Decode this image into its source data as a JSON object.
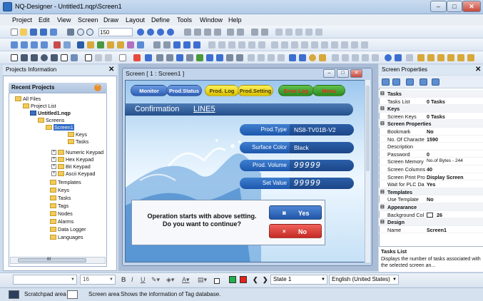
{
  "window": {
    "title": "NQ-Designer - Untitled1.nqp\\Screen1",
    "min": "–",
    "max": "□",
    "close": "✕"
  },
  "menu": [
    "Project",
    "Edit",
    "View",
    "Screen",
    "Draw",
    "Layout",
    "Define",
    "Tools",
    "Window",
    "Help"
  ],
  "toolbar": {
    "zoom": "150"
  },
  "projects_panel": {
    "title": "Projects Information",
    "close": "✕",
    "recent_header": "Recent Projects",
    "tree": [
      {
        "label": "All Files",
        "level": 0
      },
      {
        "label": "Project List",
        "level": 1
      },
      {
        "label": "Untitled1.nqp",
        "level": 2,
        "bold": true
      },
      {
        "label": "Screens",
        "level": 3
      },
      {
        "label": "Screen1",
        "level": 4,
        "selected": true
      },
      {
        "label": "Keys",
        "level": 5
      },
      {
        "label": "Tasks",
        "level": 5
      },
      {
        "label": "Numeric Keypad",
        "level": 4
      },
      {
        "label": "Hex Keypad",
        "level": 4
      },
      {
        "label": "Bit Keypad",
        "level": 4
      },
      {
        "label": "Ascii Keypad",
        "level": 4
      },
      {
        "label": "Templates",
        "level": 3
      },
      {
        "label": "Keys",
        "level": 3
      },
      {
        "label": "Tasks",
        "level": 3
      },
      {
        "label": "Tags",
        "level": 3
      },
      {
        "label": "Nodes",
        "level": 3
      },
      {
        "label": "Alarms",
        "level": 3
      },
      {
        "label": "Data Logger",
        "level": 3
      },
      {
        "label": "Languages",
        "level": 3
      }
    ],
    "scroll_grip": "III"
  },
  "screen_window": {
    "title": "Screen  [ 1 : Screen1 ]",
    "buttons": {
      "monitor": "Monitor",
      "prod_status": "Prod.Status",
      "prod_log": "Prod. Log",
      "prod_setting": "Prod.Setting",
      "error_log": "Error Log",
      "menu": "Menu"
    },
    "confirmation": "Confirmation",
    "line": "LINE5",
    "fields": [
      {
        "label": "Prod.Type",
        "value": "NS8-TV01B-V2",
        "big": false
      },
      {
        "label": "Surface Color",
        "value": "Black",
        "big": false
      },
      {
        "label": "Prod. Volume",
        "value": "99999",
        "big": true
      },
      {
        "label": "Set Value",
        "value": "99999",
        "big": true
      }
    ],
    "dialog": {
      "line1": "Operation starts with above setting.",
      "line2": "Do you want to continue?",
      "yes": "Yes",
      "no": "No",
      "yes_icon": "◙",
      "no_icon": "×"
    }
  },
  "properties_panel": {
    "title": "Screen Properties",
    "close": "✕",
    "rows": [
      {
        "type": "cat",
        "label": "Tasks"
      },
      {
        "type": "prop",
        "key": "Tasks List",
        "value": "0 Tasks"
      },
      {
        "type": "cat",
        "label": "Keys"
      },
      {
        "type": "prop",
        "key": "Screen Keys",
        "value": "0  Tasks"
      },
      {
        "type": "cat",
        "label": "Screen Properties"
      },
      {
        "type": "prop",
        "key": "Bookmark",
        "value": "No"
      },
      {
        "type": "prop",
        "key": "No. Of Characte",
        "value": "1590"
      },
      {
        "type": "prop",
        "key": "Description",
        "value": ""
      },
      {
        "type": "prop",
        "key": "Password",
        "value": "0"
      },
      {
        "type": "prop",
        "key": "Screen Memory",
        "value": "No.of Bytes - 244",
        "normal": true
      },
      {
        "type": "prop",
        "key": "Screen Columns",
        "value": "40"
      },
      {
        "type": "prop",
        "key": "Screen Print Pro",
        "value": "Display Screen"
      },
      {
        "type": "prop",
        "key": "Wait for PLC Da",
        "value": "Yes"
      },
      {
        "type": "cat",
        "label": "Templates"
      },
      {
        "type": "prop",
        "key": "Use Template",
        "value": "No"
      },
      {
        "type": "cat",
        "label": "Appearance"
      },
      {
        "type": "prop",
        "key": "Background Col",
        "value": "26",
        "swatch": true
      },
      {
        "type": "cat",
        "label": "Design"
      },
      {
        "type": "prop",
        "key": "Name",
        "value": "Screen1"
      }
    ],
    "desc_title": "Tasks List",
    "desc_text": "Displays the number of tasks associated with the selected screen an..."
  },
  "format_bar": {
    "font_size": "16",
    "state": "State 1",
    "language": "English (United States)",
    "bold": "B",
    "italic": "I",
    "underline": "U",
    "prev": "❮",
    "next": "❯"
  },
  "status_bar": {
    "scratchpad": "Scratchpad area",
    "screen_area": "Screen area",
    "message": "Shows the information of Tag database."
  },
  "colors": {
    "accent": "#316ac5",
    "green": "#22b14c",
    "red": "#e8211b"
  }
}
